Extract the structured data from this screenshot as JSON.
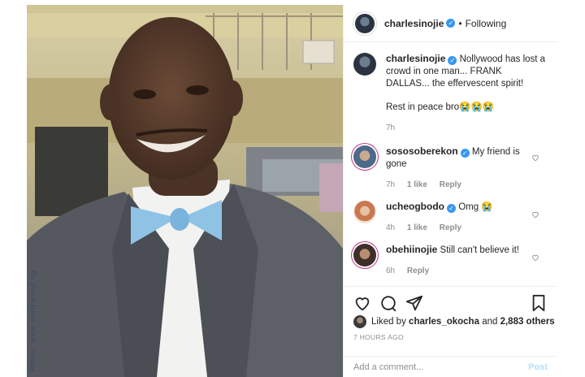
{
  "header": {
    "username": "charlesinojie",
    "separator": "•",
    "follow_status": "Following"
  },
  "photo": {
    "watermark": "Photo: www.nollywood.ng"
  },
  "caption": {
    "username": "charlesinojie",
    "text": "Nollywood has lost a crowd in one man... FRANK DALLAS... the effervescent spirit!",
    "text2": "Rest in peace bro😭😭😭",
    "time": "7h"
  },
  "comments": [
    {
      "username": "sososoberekon",
      "verified": true,
      "text": "My friend is gone",
      "time": "7h",
      "likes": "1 like",
      "reply": "Reply"
    },
    {
      "username": "ucheogbodo",
      "verified": true,
      "text": "Omg 😭",
      "time": "4h",
      "likes": "1 like",
      "reply": "Reply"
    },
    {
      "username": "obehiinojie",
      "verified": false,
      "text": "Still can't believe it!",
      "time": "6h",
      "likes": "",
      "reply": "Reply"
    }
  ],
  "likes": {
    "prefix": "Liked by ",
    "user": "charles_okocha",
    "middle": " and ",
    "count": "2,883 others"
  },
  "timestamp": "7 HOURS AGO",
  "add_comment": {
    "placeholder": "Add a comment...",
    "post_label": "Post"
  },
  "colors": {
    "verified": "#3897f0",
    "post_disabled": "#b2dffc"
  }
}
